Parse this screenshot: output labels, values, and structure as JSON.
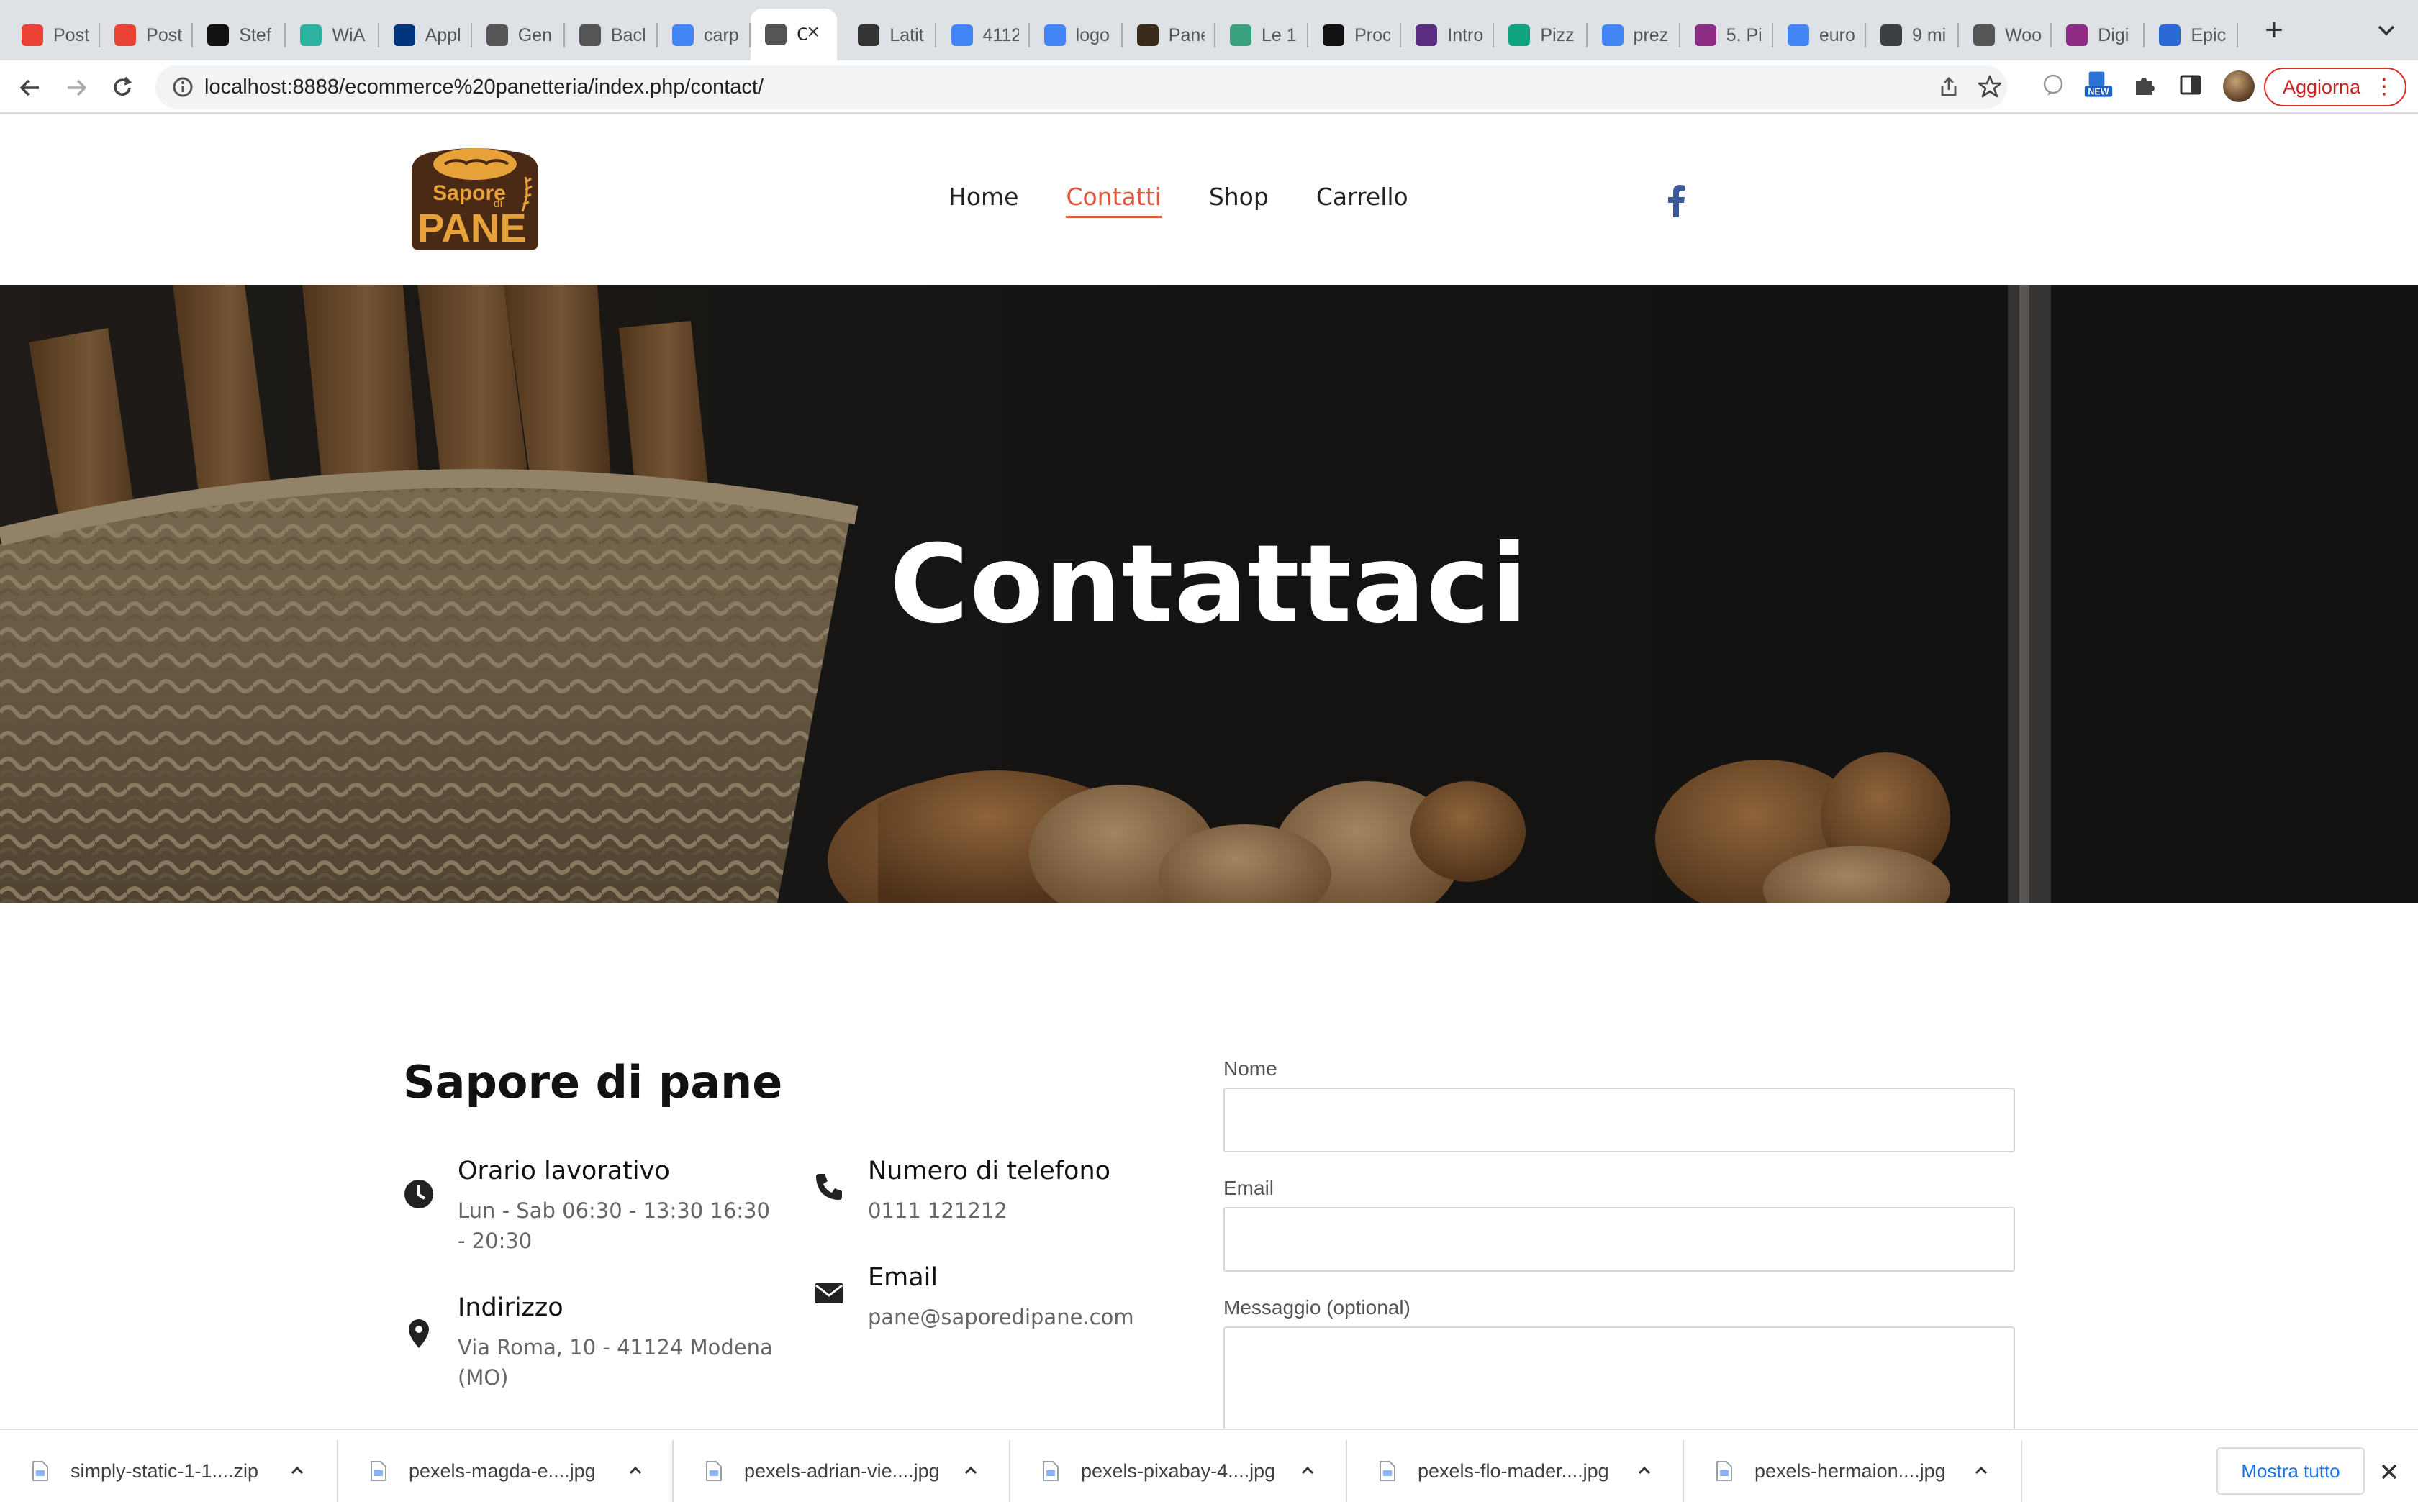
{
  "browser": {
    "tabs": [
      {
        "title": "Post",
        "favicon": "gmail-icon",
        "color": "#ea4335"
      },
      {
        "title": "Post",
        "favicon": "gmail-icon",
        "color": "#ea4335"
      },
      {
        "title": "Stef",
        "favicon": "github-icon",
        "color": "#111111"
      },
      {
        "title": "WiA",
        "favicon": "wia-icon",
        "color": "#2bb3a0"
      },
      {
        "title": "Appl",
        "favicon": "booking-icon",
        "color": "#003580"
      },
      {
        "title": "Gen",
        "favicon": "chatgpt-icon",
        "color": "#555555"
      },
      {
        "title": "Bacl",
        "favicon": "chatgpt-icon",
        "color": "#555555"
      },
      {
        "title": "carp",
        "favicon": "google-icon",
        "color": "#4285f4"
      },
      {
        "title": "C",
        "favicon": "chatgpt-icon",
        "color": "#555555",
        "active": true
      },
      {
        "title": "Latit",
        "favicon": "compass-icon",
        "color": "#333333"
      },
      {
        "title": "4112",
        "favicon": "google-icon",
        "color": "#4285f4"
      },
      {
        "title": "logo",
        "favicon": "google-icon",
        "color": "#4285f4"
      },
      {
        "title": "Pane",
        "favicon": "s-logo-icon",
        "color": "#3a2a1a"
      },
      {
        "title": "Le 1",
        "favicon": "d-logo-icon",
        "color": "#3aa17e"
      },
      {
        "title": "Proc",
        "favicon": "m-logo-icon",
        "color": "#111111"
      },
      {
        "title": "Intro",
        "favicon": "openai-icon",
        "color": "#5a2d82"
      },
      {
        "title": "Pizz",
        "favicon": "openai-icon",
        "color": "#10a37f"
      },
      {
        "title": "prez",
        "favicon": "google-icon",
        "color": "#4285f4"
      },
      {
        "title": "5. Pi",
        "favicon": "stripes-icon",
        "color": "#8e2b84"
      },
      {
        "title": "euro",
        "favicon": "google-icon",
        "color": "#4285f4"
      },
      {
        "title": "9 mi",
        "favicon": "wave-icon",
        "color": "#3c4043"
      },
      {
        "title": "Woo",
        "favicon": "wordpress-icon",
        "color": "#555555"
      },
      {
        "title": "Digi",
        "favicon": "stripes-icon",
        "color": "#8e2b84"
      },
      {
        "title": "Epic",
        "favicon": "epic-icon",
        "color": "#2b6ad6"
      }
    ],
    "url": "localhost:8888/ecommerce%20panetteria/index.php/contact/",
    "update_label": "Aggiorna",
    "new_badge": "NEW"
  },
  "site": {
    "logo_text_top": "Sapore",
    "logo_text_di": "di",
    "logo_text_bottom": "PANE",
    "nav": [
      {
        "label": "Home",
        "active": false
      },
      {
        "label": "Contatti",
        "active": true
      },
      {
        "label": "Shop",
        "active": false
      },
      {
        "label": "Carrello",
        "active": false
      }
    ],
    "social": [
      {
        "name": "facebook-icon",
        "color": "#3b5998"
      },
      {
        "name": "instagram-icon",
        "color": "#262626"
      },
      {
        "name": "whatsapp-icon",
        "color": "#5fcf6f"
      }
    ],
    "accent": "#e0583b"
  },
  "hero": {
    "title": "Contattaci"
  },
  "contact": {
    "brand_title": "Sapore di pane",
    "hours_label": "Orario lavorativo",
    "hours_value": "Lun - Sab 06:30 - 13:30 16:30 - 20:30",
    "address_label": "Indirizzo",
    "address_value": "Via Roma, 10 - 41124 Modena (MO)",
    "phone_label": "Numero di telefono",
    "phone_value": "0111 121212",
    "email_label": "Email",
    "email_value": "pane@saporedipane.com"
  },
  "form": {
    "name_label": "Nome",
    "email_label": "Email",
    "message_label": "Messaggio (optional)"
  },
  "downloads": {
    "items": [
      "simply-static-1-1....zip",
      "pexels-magda-e....jpg",
      "pexels-adrian-vie....jpg",
      "pexels-pixabay-4....jpg",
      "pexels-flo-mader....jpg",
      "pexels-hermaion....jpg"
    ],
    "show_all": "Mostra tutto"
  }
}
